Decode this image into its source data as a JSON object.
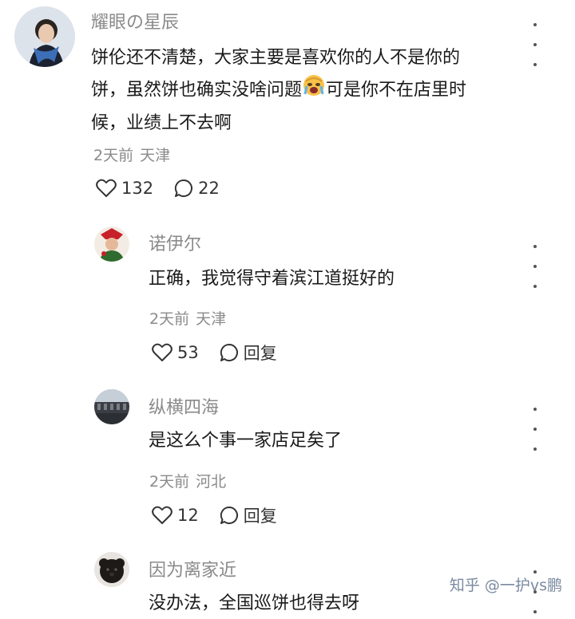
{
  "comments": [
    {
      "username": "耀眼の星辰",
      "text_1": "饼伦还不清楚，大家主要是喜欢你的人不是你的",
      "text_2a": "饼，虽然饼也确实没啥问题",
      "emoji": "crying-face-emoji",
      "text_2b": "可是你不在店里时",
      "text_3": "候，业绩上不去啊",
      "time": "2天前",
      "location": "天津",
      "likes": "132",
      "replies": "22"
    },
    {
      "username": "诺伊尔",
      "text": "正确，我觉得守着滨江道挺好的",
      "time": "2天前",
      "location": "天津",
      "likes": "53",
      "reply_label": "回复"
    },
    {
      "username": "纵横四海",
      "text": "是这么个事一家店足矣了",
      "time": "2天前",
      "location": "河北",
      "likes": "12",
      "reply_label": "回复"
    },
    {
      "username": "因为离家近",
      "text": "没办法，全国巡饼也得去呀"
    }
  ],
  "watermark": "知乎 @一护vs鹏",
  "icons": {
    "more": "more-dots-icon",
    "like": "heart-icon",
    "comment": "comment-bubble-icon"
  }
}
